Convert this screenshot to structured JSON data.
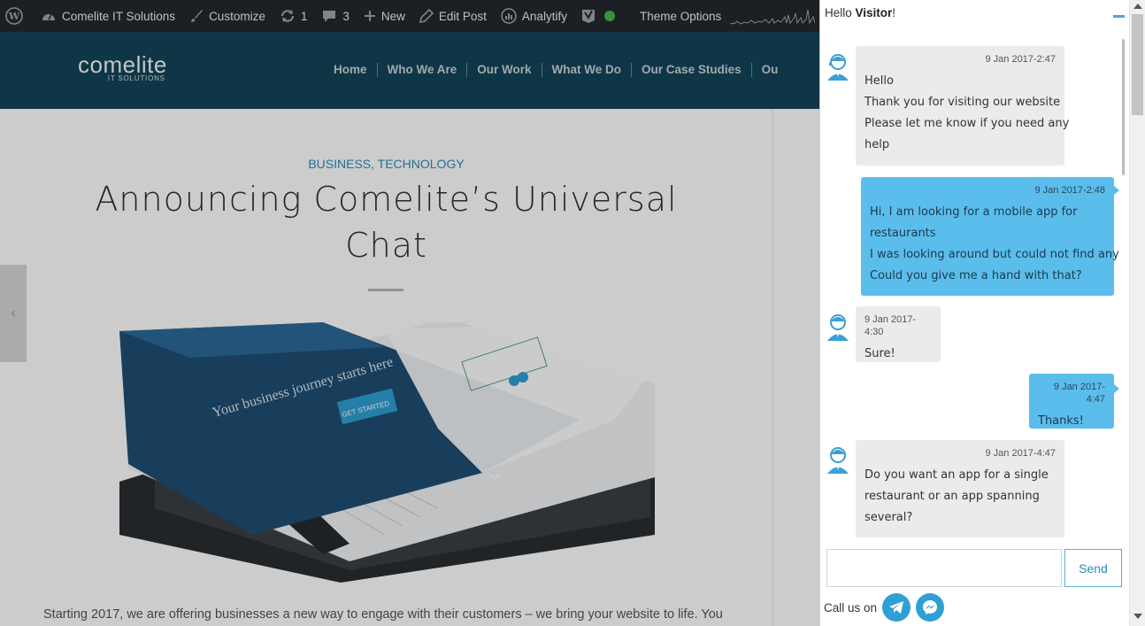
{
  "admin_bar": {
    "site_name": "Comelite IT Solutions",
    "customize": "Customize",
    "updates_count": "1",
    "comments_count": "3",
    "new_label": "New",
    "edit_post": "Edit Post",
    "analytify": "Analytify",
    "theme_options": "Theme Options",
    "status_color": "#46b450"
  },
  "site": {
    "logo_text": "comelite",
    "logo_subtext": "IT SOLUTIONS",
    "nav": [
      "Home",
      "Who We Are",
      "Our Work",
      "What We Do",
      "Our Case Studies",
      "Ou"
    ]
  },
  "post": {
    "categories": "BUSINESS, TECHNOLOGY",
    "title": "Announcing Comelite’s Universal Chat",
    "prev_arrow": "‹",
    "excerpt": "Starting 2017, we are offering businesses a new way to engage with their customers – we bring your website to life. You",
    "hero_banner_text": "Your business journey starts here",
    "hero_button": "GET STARTED"
  },
  "chat": {
    "greeting_prefix": "Hello",
    "greeting_name": "Visitor",
    "greeting_suffix": "!",
    "messages": [
      {
        "from": "agent",
        "time": "9 Jan 2017-2:47",
        "lines": [
          "Hello",
          "Thank you for visiting our website",
          "Please let me know if you need any",
          "help"
        ]
      },
      {
        "from": "visitor",
        "time": "9 Jan 2017-2:48",
        "lines": [
          "Hi, I am looking for a mobile app for",
          "restaurants",
          "I was looking around but could not find any",
          "Could you give me a hand with that?"
        ]
      },
      {
        "from": "agent",
        "time": "9 Jan 2017-4:30",
        "lines": [
          "Sure!"
        ]
      },
      {
        "from": "visitor",
        "time": "9 Jan 2017-4:47",
        "lines": [
          "Thanks!"
        ]
      },
      {
        "from": "agent",
        "time": "9 Jan 2017-4:47",
        "lines": [
          "Do you want an app for a single",
          "restaurant or an app spanning",
          "several?"
        ]
      }
    ],
    "input_value": "",
    "input_placeholder": "",
    "send_label": "Send",
    "call_us_label": "Call us on",
    "call_icons": [
      "telegram-icon",
      "messenger-icon"
    ],
    "accent_color": "#5bbdec"
  }
}
